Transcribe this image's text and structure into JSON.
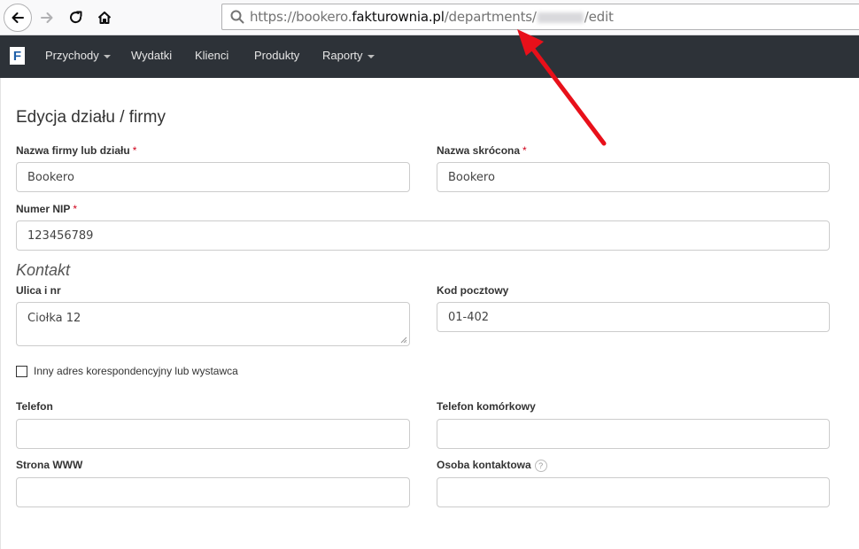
{
  "browser": {
    "url_prefix": "https://bookero.",
    "url_domain": "fakturownia.pl",
    "url_path_start": "/departments/",
    "url_path_end": "/edit"
  },
  "nav": {
    "logo": "F",
    "items": [
      {
        "label": "Przychody",
        "dropdown": true
      },
      {
        "label": "Wydatki",
        "dropdown": false
      },
      {
        "label": "Klienci",
        "dropdown": false
      },
      {
        "label": "Produkty",
        "dropdown": false
      },
      {
        "label": "Raporty",
        "dropdown": true
      }
    ]
  },
  "form": {
    "title": "Edycja działu / firmy",
    "name": {
      "label": "Nazwa firmy lub działu",
      "required_mark": "*",
      "value": "Bookero"
    },
    "short_name": {
      "label": "Nazwa skrócona",
      "required_mark": "*",
      "value": "Bookero"
    },
    "nip": {
      "label": "Numer NIP",
      "required_mark": "*",
      "value": "123456789"
    },
    "contact_section": "Kontakt",
    "street": {
      "label": "Ulica i nr",
      "value": "Ciołka 12"
    },
    "postal": {
      "label": "Kod pocztowy",
      "value": "01-402"
    },
    "alt_address": {
      "label": "Inny adres korespondencyjny lub wystawca",
      "checked": false
    },
    "phone": {
      "label": "Telefon",
      "value": ""
    },
    "mobile": {
      "label": "Telefon komórkowy",
      "value": ""
    },
    "www": {
      "label": "Strona WWW",
      "value": ""
    },
    "contact_person": {
      "label": "Osoba kontaktowa",
      "help": "?",
      "value": ""
    }
  },
  "colors": {
    "navbar": "#2d3238",
    "required": "#d0021b",
    "arrow": "#e8101a"
  }
}
